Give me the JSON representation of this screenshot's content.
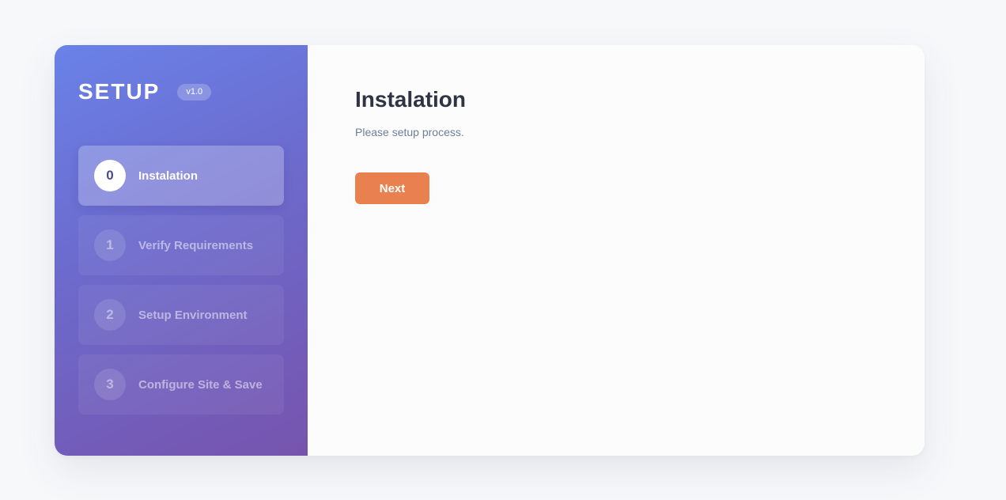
{
  "sidebar": {
    "brand": "SETUP",
    "version": "v1.0",
    "steps": [
      {
        "number": "0",
        "label": "Instalation",
        "active": true
      },
      {
        "number": "1",
        "label": "Verify Requirements",
        "active": false
      },
      {
        "number": "2",
        "label": "Setup Environment",
        "active": false
      },
      {
        "number": "3",
        "label": "Configure Site & Save",
        "active": false
      }
    ]
  },
  "main": {
    "title": "Instalation",
    "subtitle": "Please setup process.",
    "next_label": "Next"
  },
  "colors": {
    "accent": "#e9804f",
    "sidebar_gradient_start": "#6a82e8",
    "sidebar_gradient_end": "#7654ad",
    "title": "#2e3445"
  }
}
